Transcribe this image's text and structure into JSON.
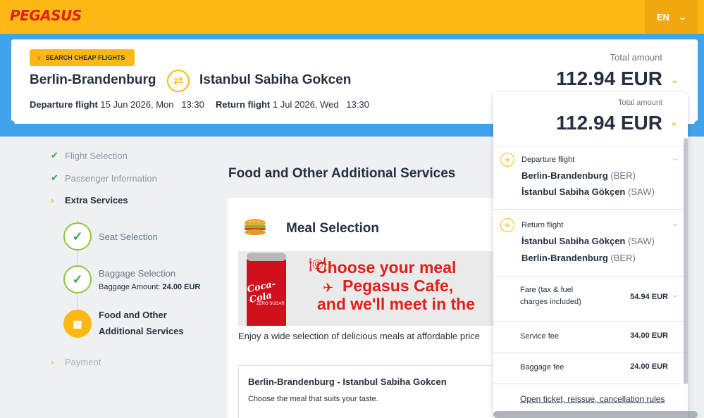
{
  "header": {
    "logo": "PEGASUS",
    "language": "EN"
  },
  "summary": {
    "cheap_flights_label": "SEARCH CHEAP FLIGHTS",
    "from_city": "Berlin-Brandenburg",
    "to_city": "Istanbul Sabiha Gokcen",
    "departure_label": "Departure flight",
    "departure_value": "15 Jun 2026, Mon   13:30",
    "return_label": "Return flight",
    "return_value": "1 Jul 2026, Wed   13:30",
    "total_label": "Total amount",
    "total_amount": "112.94 EUR"
  },
  "steps": {
    "flight_selection": "Flight Selection",
    "passenger_information": "Passenger Information",
    "extra_services": "Extra Services",
    "seat_selection": "Seat Selection",
    "baggage_selection": "Baggage Selection",
    "baggage_amount_label": "Baggage Amount:",
    "baggage_amount_value": "24.00 EUR",
    "food_line1": "Food and Other",
    "food_line2": "Additional Services",
    "payment": "Payment"
  },
  "main": {
    "title": "Food and Other Additional Services",
    "meal_title": "Meal Selection",
    "banner_line1": "Choose your meal",
    "banner_line2": "Pegasus Cafe,",
    "banner_line3": "and we'll meet in the",
    "can_brand": "Coca-Cola",
    "can_sub": "ZERO SUGAR",
    "enjoy_text": "Enjoy a wide selection of delicious meals at affordable price",
    "route_title": "Berlin-Brandenburg - Istanbul Sabiha Gokcen",
    "route_sub": "Choose the meal that suits your taste."
  },
  "dropdown": {
    "total_label": "Total amount",
    "total_amount": "112.94 EUR",
    "departure_label": "Departure flight",
    "dep_from": "Berlin-Brandenburg",
    "dep_from_code": "(BER)",
    "dep_to": "İstanbul Sabiha Gökçen",
    "dep_to_code": "(SAW)",
    "return_label": "Return flight",
    "ret_from": "İstanbul Sabiha Gökçen",
    "ret_from_code": "(SAW)",
    "ret_to": "Berlin-Brandenburg",
    "ret_to_code": "(BER)",
    "fare_label_1": "Fare (tax & fuel",
    "fare_label_2": "charges included)",
    "fare_value": "54.94 EUR",
    "service_fee_label": "Service fee",
    "service_fee_value": "34.00 EUR",
    "baggage_fee_label": "Baggage fee",
    "baggage_fee_value": "24.00 EUR",
    "rules_link": "Open ticket, reissue, cancellation rules"
  },
  "colors": {
    "brand_yellow": "#fdb813",
    "brand_red": "#e0201b",
    "header_blue": "#41a3ec",
    "done_green": "#3aa642"
  },
  "icons": [
    "chevron-down-icon",
    "swap-icon",
    "check-icon",
    "services-icon",
    "plane-icon",
    "sandwich-icon",
    "caret-up-icon"
  ]
}
